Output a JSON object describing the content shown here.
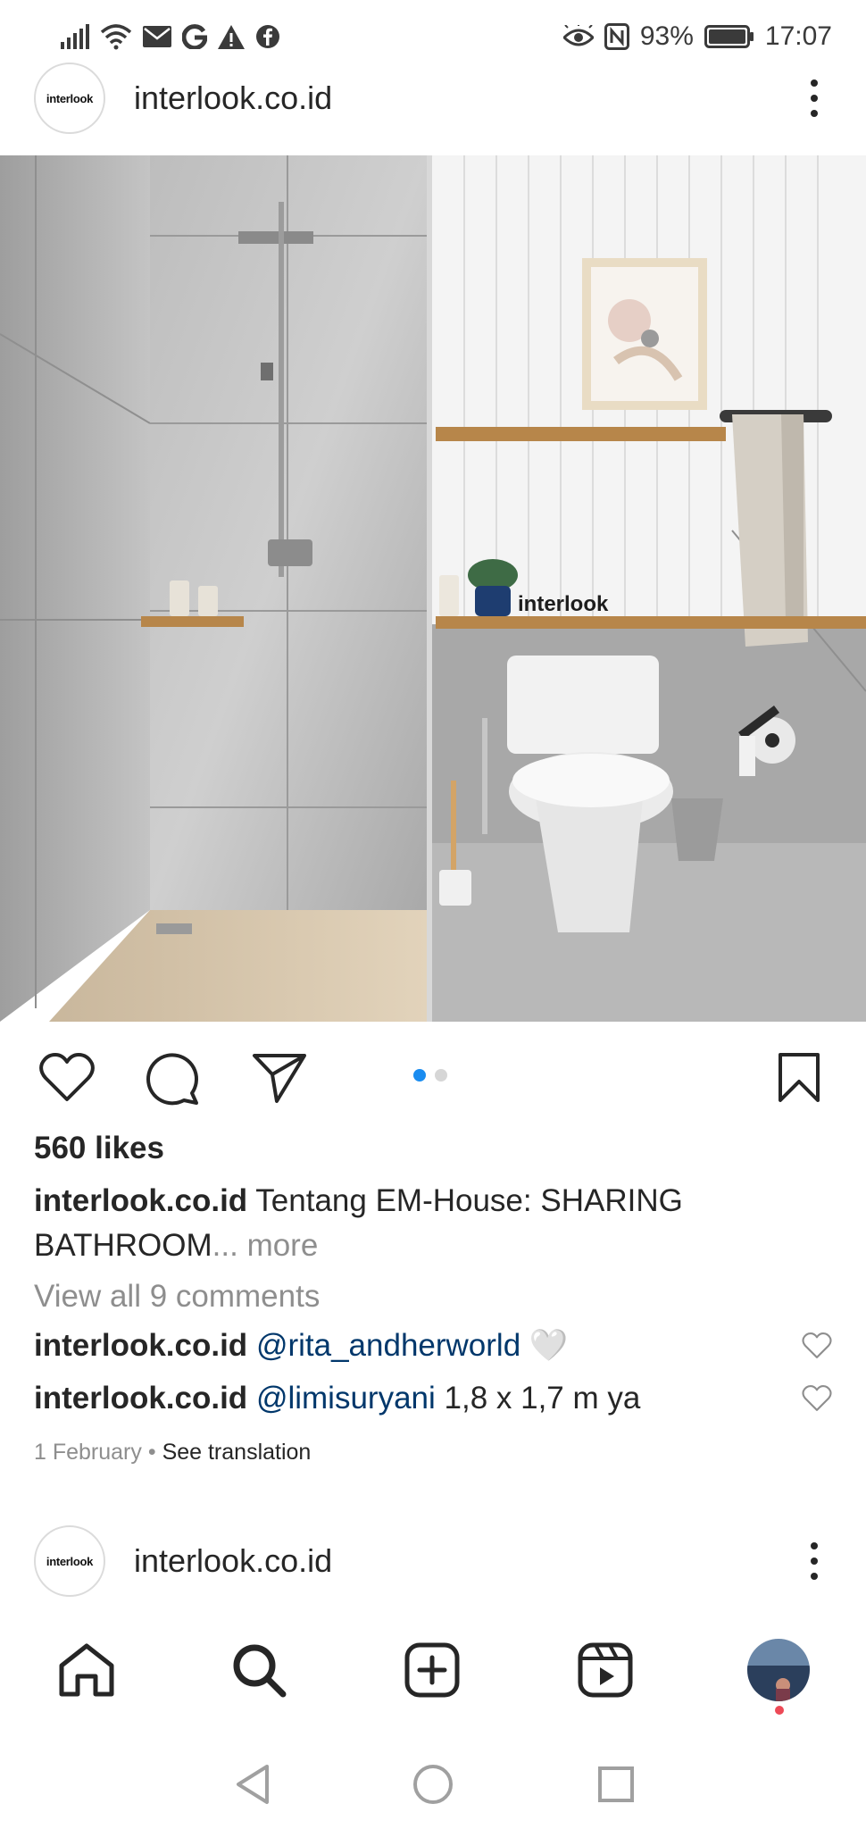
{
  "status_bar": {
    "icons_left": [
      "signal-icon",
      "wifi-icon",
      "mail-icon",
      "google-icon",
      "warning-icon",
      "facebook-icon"
    ],
    "icons_right": [
      "eye-icon",
      "nfc-icon",
      "battery-icon"
    ],
    "battery": "93%",
    "time": "17:07"
  },
  "post": {
    "avatar_text": "interlook",
    "handle": "interlook.co.id",
    "image": {
      "watermark": "interlook"
    },
    "carousel": {
      "count": 2,
      "active": 1
    },
    "likes": "560 likes",
    "caption": {
      "author": "interlook.co.id",
      "text": "Tentang EM-House: SHARING BATHROOM",
      "ellipsis": "...",
      "more": "more"
    },
    "view_comments": "View all 9 comments",
    "comments": [
      {
        "author": "interlook.co.id",
        "mention": "@rita_andherworld",
        "emoji": "🤍",
        "text": ""
      },
      {
        "author": "interlook.co.id",
        "mention": "@limisuryani",
        "emoji": "",
        "text": "1,8 x 1,7 m ya"
      }
    ],
    "date": "1 February",
    "separator": "•",
    "see_translation": "See translation"
  },
  "next_post": {
    "avatar_text": "interlook",
    "handle": "interlook.co.id"
  },
  "colors": {
    "accent": "#1a8cf0",
    "text": "#262626",
    "muted": "#8e8e8e",
    "mention": "#00376b",
    "notification": "#ed4956"
  }
}
